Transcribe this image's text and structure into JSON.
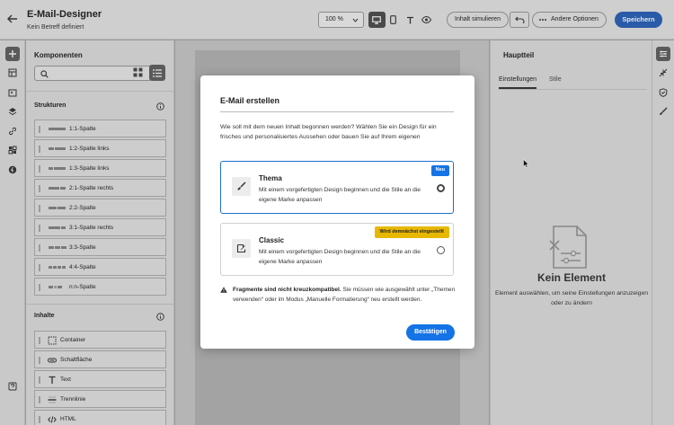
{
  "header": {
    "title": "E-Mail-Designer",
    "subtitle": "Kein Betreff definiert",
    "zoom": "100 %",
    "simulate_label": "Inhalt simulieren",
    "more_options_label": "Andere Optionen",
    "save_label": "Speichern",
    "active_view": "desktop"
  },
  "left_panel": {
    "title": "Komponenten",
    "search_placeholder": "",
    "structures_header": "Strukturen",
    "structures": [
      "1:1-Spalte",
      "1:2-Spalte links",
      "1:3-Spalte links",
      "2:1-Spalte rechts",
      "2:2-Spalte",
      "3:1-Spalte rechts",
      "3:3-Spalte",
      "4:4-Spalte",
      "n:n-Spalte"
    ],
    "contents_header": "Inhalte",
    "contents": [
      {
        "label": "Container",
        "icon": "container-icon"
      },
      {
        "label": "Schaltfläche",
        "icon": "button-icon"
      },
      {
        "label": "Text",
        "icon": "text-icon"
      },
      {
        "label": "Trennlinie",
        "icon": "divider-icon"
      },
      {
        "label": "HTML",
        "icon": "html-icon"
      }
    ]
  },
  "right_panel": {
    "title": "Hauptteil",
    "tabs": [
      "Einstellungen",
      "Stile"
    ],
    "active_tab": "Einstellungen",
    "empty_title": "Kein Element",
    "empty_text": "Element auswählen, um seine Einstellungen anzuzeigen oder zu ändern"
  },
  "modal": {
    "title": "E-Mail erstellen",
    "intro": "Wie soll mit dem neuen Inhalt begonnen werden? Wählen Sie ein Design für ein frisches und personalisiertes Aussehen oder bauen Sie auf Ihrem eigenen",
    "options": [
      {
        "title": "Thema",
        "description": "Mit einem vorgefertigten Design beginnen und die Stile an die eigene Marke anpassen",
        "badge": "Neu",
        "selected": true
      },
      {
        "title": "Classic",
        "description": "Mit einem vorgefertigten Design beginnen und die Stile an die eigene Marke anpassen",
        "badge": "Wird demnächst eingestellt",
        "selected": false
      }
    ],
    "warning_bold": "Fragmente sind nicht kreuzkompatibel.",
    "warning_text": " Sie müssen wie ausgewählt unter „Themen verwenden“ oder im Modus „Manuelle Formatierung“ neu erstellt werden.",
    "confirm_label": "Bestätigen"
  },
  "colors": {
    "primary": "#1473e6",
    "badge_new": "#1473e6",
    "badge_deprecated": "#e8b800",
    "save_button": "#2a5ba8"
  }
}
